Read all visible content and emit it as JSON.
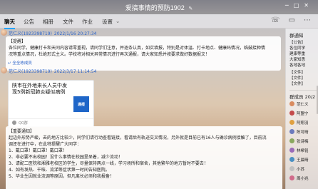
{
  "window": {
    "title": "爱搞事情的预防1902",
    "edit_icon": "pencil-icon",
    "controls": [
      "─",
      "□",
      "✕"
    ]
  },
  "tabs": [
    {
      "label": "聊天"
    },
    {
      "label": "公告"
    },
    {
      "label": "相册"
    },
    {
      "label": "文件"
    },
    {
      "label": "作业"
    },
    {
      "label": "设置"
    }
  ],
  "tab_icons": [
    "phone-icon",
    "video-icon",
    "more-icon"
  ],
  "messages": [
    {
      "sender": "范仁义",
      "qq": "(1923398719)",
      "time": "2022/1/16 20:27:34",
      "lines": [
        "【提醒】",
        "各位同学，健康打卡和天同内容请零重视，请同学们注意，并逐条认真，如实填报，特别是对体温、打卡地点、健康码情况，临鼓接种情",
        "况等重点情况，杜绝形式主义。学校将对相关异常情况进行再次通报，请大家知悉并按要求做好数据报文！"
      ],
      "recall": "↵ 全全栋成员"
    },
    {
      "sender": "范仁义",
      "qq": "(1923398719)",
      "time": "2022/3/17 11:14:54",
      "card": {
        "title": "陕市在外地来长人员中发现5例新冠肺炎疑似病例",
        "thumb": "通报",
        "source": "QQ群"
      }
    },
    {
      "lines": [
        "【重要通知】",
        "起边外形势严峻，去的地方比较少，同学们请行动查看链接，看请后有轨迹交叉情况，另外就是目前已有16人与确诊病例接触了，目前流",
        "调还在进行中，在此特提醒广大同学：",
        "1、戴口罩！戴口罩！戴口罩！",
        "2、非必要不出校园！没什么事情在校园里呆着，减少流动！",
        "3、请配二医院和湘雅老校区的学生，尽量保持两点一线，学习场所和宿舍，其他繁华的地方暂时不要去！",
        "4、如有发热、干咳、流涕等症状第一时间告知医院。",
        "5、毕业生因就业流调等原因，但凡离长必须和我报备！"
      ]
    }
  ],
  "sidebar": {
    "notice_head": "群通知",
    "notice_label": "【公告】",
    "notice_lines": [
      "各位同学",
      "建康等重",
      "大家知悉",
      "各地各地"
    ],
    "doc_lines": [
      "【文件】",
      "【文件】",
      "【文件】"
    ],
    "member_head": "群成员 20/2",
    "members": [
      {
        "name": "范仁义",
        "color": "#d98b5f"
      },
      {
        "name": "阿盟宁",
        "color": "#c44a4a"
      },
      {
        "name": "阿翔羽",
        "color": "#e0a040"
      },
      {
        "name": "陈可晴",
        "color": "#6c7bbd"
      },
      {
        "name": "张诗梅",
        "color": "#8aa85f"
      },
      {
        "name": "林希铭",
        "color": "#9a6bb8"
      },
      {
        "name": "王晨晴",
        "color": "#4a90c2"
      },
      {
        "name": "小苏",
        "color": "#c0c0c0"
      },
      {
        "name": "周小兆",
        "color": "#d06a8a"
      }
    ]
  }
}
